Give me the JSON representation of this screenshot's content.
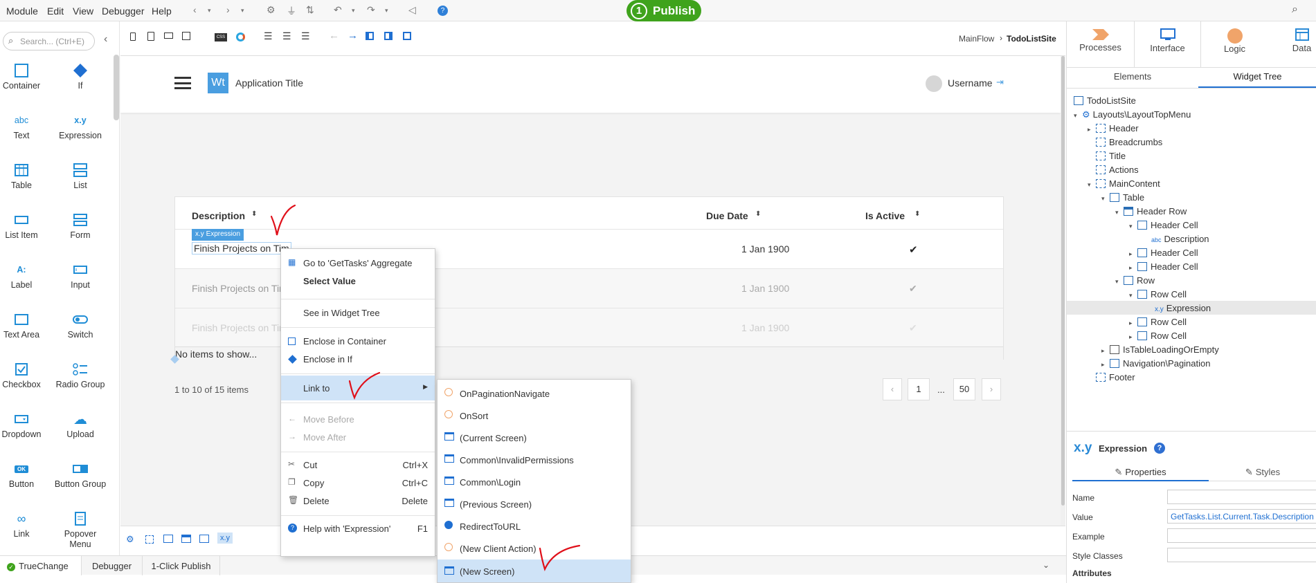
{
  "menu": [
    "Module",
    "Edit",
    "View",
    "Debugger",
    "Help"
  ],
  "publish": {
    "number": "1",
    "label": "Publish"
  },
  "colors": {
    "accent": "#1f8dd6",
    "publish": "#3fa31c",
    "highlight": "#cfe3f7"
  },
  "toolbox": {
    "search_placeholder": "Search... (Ctrl+E)",
    "items": [
      {
        "icon": "container-icon",
        "label": "Container"
      },
      {
        "icon": "if-icon",
        "label": "If"
      },
      {
        "icon": "text-icon",
        "label": "Text",
        "glyph": "abc"
      },
      {
        "icon": "expression-icon",
        "label": "Expression",
        "glyph": "x.y"
      },
      {
        "icon": "table-icon",
        "label": "Table"
      },
      {
        "icon": "list-icon",
        "label": "List"
      },
      {
        "icon": "list-item-icon",
        "label": "List Item"
      },
      {
        "icon": "form-icon",
        "label": "Form"
      },
      {
        "icon": "label-icon",
        "label": "Label",
        "glyph": "A:"
      },
      {
        "icon": "input-icon",
        "label": "Input"
      },
      {
        "icon": "text-area-icon",
        "label": "Text Area"
      },
      {
        "icon": "switch-icon",
        "label": "Switch"
      },
      {
        "icon": "checkbox-icon",
        "label": "Checkbox"
      },
      {
        "icon": "radio-group-icon",
        "label": "Radio Group"
      },
      {
        "icon": "dropdown-icon",
        "label": "Dropdown"
      },
      {
        "icon": "upload-icon",
        "label": "Upload"
      },
      {
        "icon": "button-icon",
        "label": "Button",
        "glyph": "OK"
      },
      {
        "icon": "button-group-icon",
        "label": "Button Group"
      },
      {
        "icon": "link-icon",
        "label": "Link"
      },
      {
        "icon": "popover-menu-icon",
        "label": "Popover Menu"
      }
    ]
  },
  "breadcrumb": {
    "flow": "MainFlow",
    "screen": "TodoListSite"
  },
  "app": {
    "logo": "Wt",
    "title": "Application Title",
    "username": "Username"
  },
  "table": {
    "headers": [
      "Description",
      "Due Date",
      "Is Active"
    ],
    "badge": "Expression",
    "badge_glyph": "x.y",
    "rows": [
      {
        "description": "Finish Projects on Tim",
        "due": "1 Jan 1900"
      },
      {
        "description": "Finish Projects on Tin",
        "due": "1 Jan 1900"
      },
      {
        "description": "Finish Projects on Tin",
        "due": "1 Jan 1900"
      }
    ],
    "empty": "No items to show...",
    "count": "1 to 10 of 15 items",
    "pages": {
      "first": "1",
      "ellipsis": "...",
      "last": "50"
    }
  },
  "context_menu": {
    "goto": "Go to 'GetTasks' Aggregate",
    "select_value": "Select Value",
    "see_tree": "See in Widget Tree",
    "enclose_container": "Enclose in Container",
    "enclose_if": "Enclose in If",
    "link_to": "Link to",
    "move_before": "Move Before",
    "move_after": "Move After",
    "cut": "Cut",
    "cut_key": "Ctrl+X",
    "copy": "Copy",
    "copy_key": "Ctrl+C",
    "delete": "Delete",
    "delete_key": "Delete",
    "help": "Help with 'Expression'",
    "help_key": "F1"
  },
  "submenu": [
    "OnPaginationNavigate",
    "OnSort",
    "(Current Screen)",
    "Common\\InvalidPermissions",
    "Common\\Login",
    "(Previous Screen)",
    "RedirectToURL",
    "(New Client Action)",
    "(New Screen)"
  ],
  "right_tabs": [
    "Processes",
    "Interface",
    "Logic",
    "Data"
  ],
  "sub_tabs": [
    "Elements",
    "Widget Tree"
  ],
  "widget_tree": [
    "TodoListSite",
    "Layouts\\LayoutTopMenu",
    "Header",
    "Breadcrumbs",
    "Title",
    "Actions",
    "MainContent",
    "Table",
    "Header Row",
    "Header Cell",
    "Description",
    "Header Cell",
    "Header Cell",
    "Row",
    "Row Cell",
    "Expression",
    "Row Cell",
    "Row Cell",
    "IsTableLoadingOrEmpty",
    "Navigation\\Pagination",
    "Footer"
  ],
  "properties": {
    "glyph": "x.y",
    "title": "Expression",
    "tabs": [
      "Properties",
      "Styles"
    ],
    "fields": [
      "Name",
      "Value",
      "Example",
      "Style Classes"
    ],
    "value": "GetTasks.List.Current.Task.Description",
    "attributes": "Attributes"
  },
  "bottom_tabs": [
    "TrueChange",
    "Debugger",
    "1-Click Publish"
  ]
}
